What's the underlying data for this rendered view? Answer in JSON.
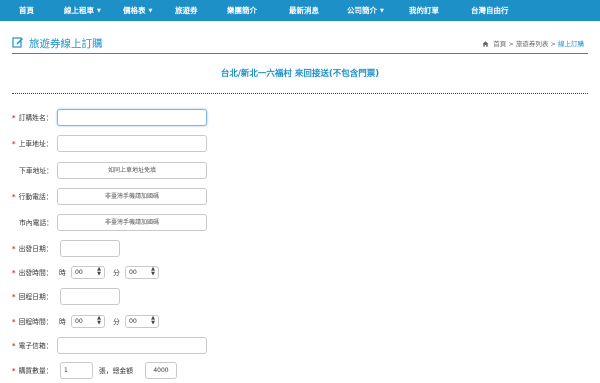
{
  "nav": {
    "items": [
      {
        "label": "首頁",
        "dropdown": false
      },
      {
        "label": "線上租車",
        "dropdown": true
      },
      {
        "label": "價格表",
        "dropdown": true
      },
      {
        "label": "旅遊券",
        "dropdown": false
      },
      {
        "label": "樂團簡介",
        "dropdown": false
      },
      {
        "label": "最新消息",
        "dropdown": false
      },
      {
        "label": "公司簡介",
        "dropdown": true
      },
      {
        "label": "我的訂單",
        "dropdown": false
      },
      {
        "label": "台灣自由行",
        "dropdown": false
      }
    ],
    "caret": "▼",
    "background": "#1e90c8"
  },
  "header": {
    "title": "旅遊券線上訂購",
    "icon": "edit-icon",
    "breadcrumb": {
      "home": "首頁",
      "separator1": ">",
      "list": "旅遊券列表",
      "separator2": ">",
      "current": "線上訂購"
    }
  },
  "route_title": "台北/新北一六福村 來回接送(不包含門票)",
  "form": {
    "required_mark": "*",
    "name_label": "訂購姓名：",
    "pickup_label": "上車地址：",
    "dropoff_label": "下車地址：",
    "dropoff_placeholder": "如同上車地址免填",
    "mobile_label": "行動電話：",
    "mobile_placeholder": "非臺灣手機請加國碼",
    "phone_label": "市內電話：",
    "phone_placeholder": "非臺灣手機請加國碼",
    "depart_date_label": "出發日期：",
    "depart_time_label": "出發時間：",
    "return_date_label": "回程日期：",
    "return_time_label": "回程時間：",
    "hour_text": "時",
    "minute_text": "分",
    "hour_value": "00",
    "minute_value": "00",
    "email_label": "電子信箱：",
    "qty_label": "購買數量：",
    "qty_value": "1",
    "total_text": "張，總金額",
    "total_value": "4000"
  },
  "colors": {
    "accent": "#1e90c8",
    "required": "#d9302c"
  }
}
